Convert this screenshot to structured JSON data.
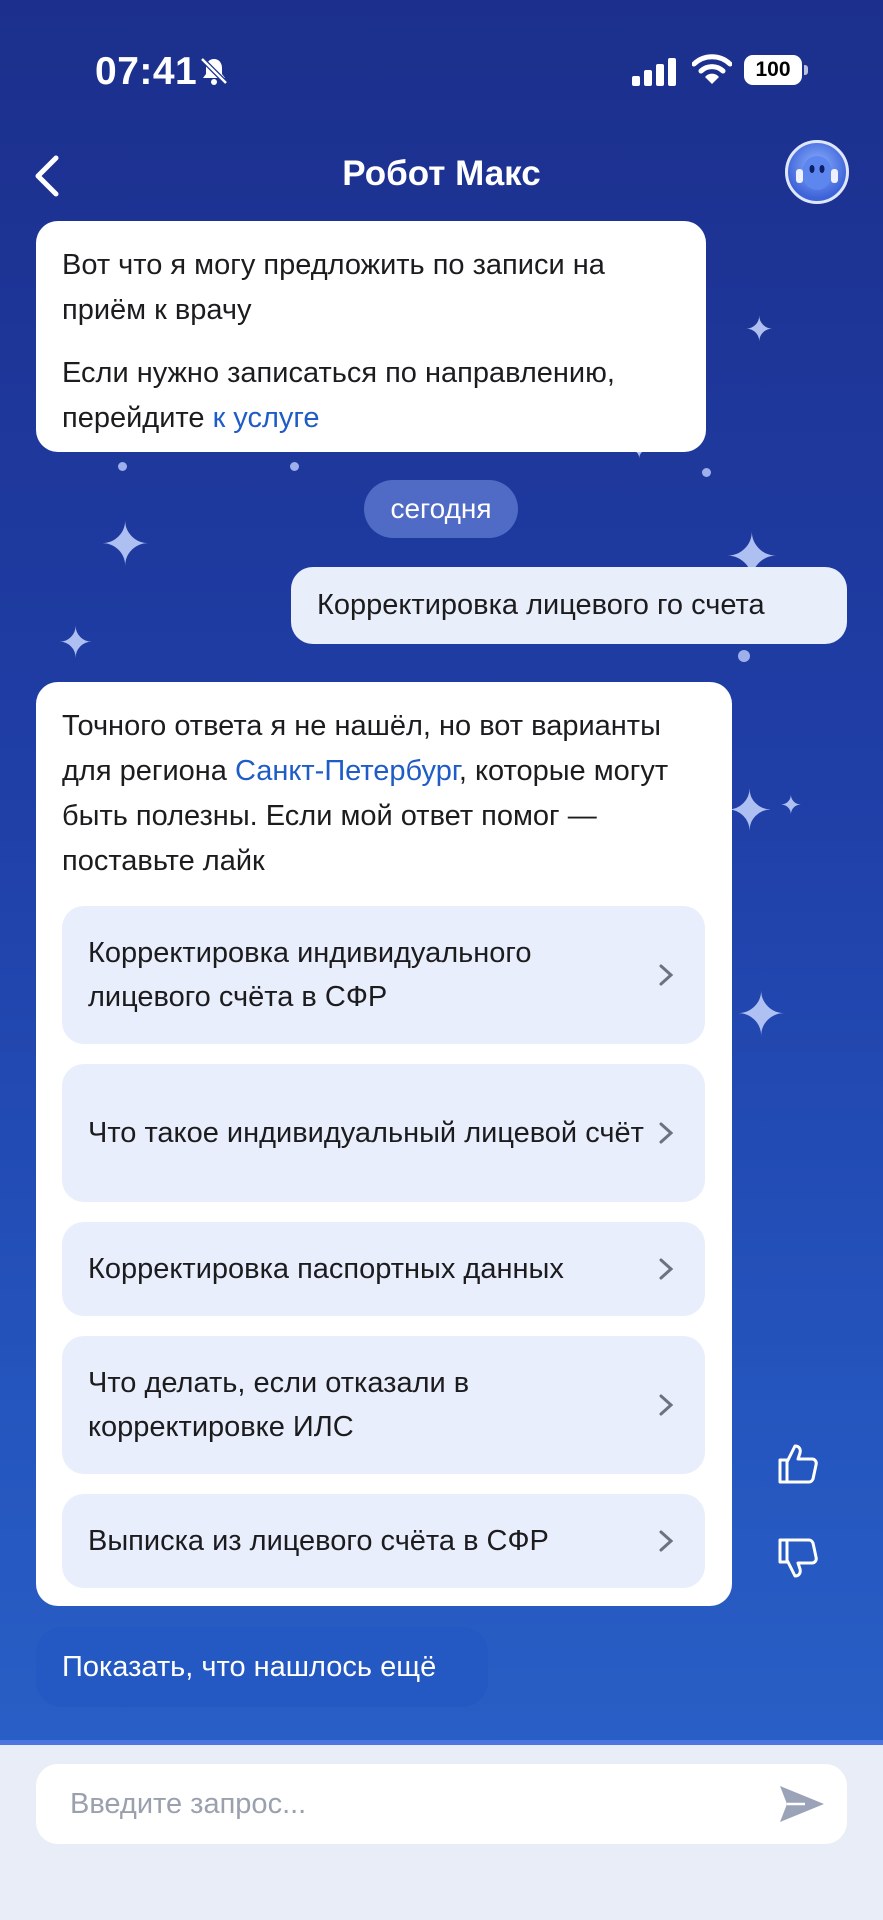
{
  "status_bar": {
    "time": "07:41",
    "battery": "100"
  },
  "header": {
    "title": "Робот Макс"
  },
  "messages": {
    "bot_first": {
      "line1": "Вот что я могу предложить по записи на приём к врачу",
      "line2_text": "Если нужно записаться по направлению, перейдите ",
      "line2_link": "к услуге"
    },
    "date_separator": "сегодня",
    "user_message": "Корректировка лицевого го счета",
    "bot_second": {
      "text_before": "Точного ответа я не нашёл, но вот варианты для региона ",
      "region_link": "Санкт-Петербург",
      "text_after": ", которые могут быть полезны. Если мой ответ помог — поставьте лайк"
    },
    "suggestions": [
      "Корректировка индивидуального лицевого счёта в СФР",
      "Что такое индивидуальный лицевой счёт",
      "Корректировка паспортных данных",
      "Что делать, если отказали в корректировке ИЛС",
      "Выписка из лицевого счёта в СФР"
    ],
    "more_button": "Показать, что нашлось ещё"
  },
  "composer": {
    "placeholder": "Введите запрос..."
  },
  "colors": {
    "accent": "#1f5cc7",
    "suggestion_bg": "#e8eefb",
    "button_bg": "#2458c2"
  }
}
